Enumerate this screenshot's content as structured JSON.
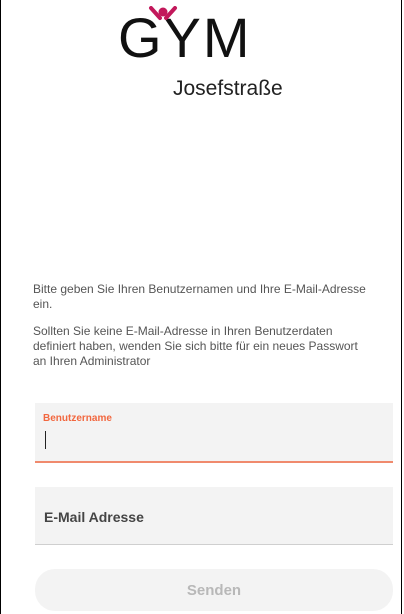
{
  "logo": {
    "title": "GYM",
    "subtitle": "Josefstraße",
    "mark_color": "#c2185b"
  },
  "instructions": {
    "line1": "Bitte geben Sie Ihren Benutzernamen und Ihre E-Mail-Adresse ein.",
    "line2": "Sollten Sie keine E-Mail-Adresse in Ihren Benutzerdaten definiert haben, wenden Sie sich bitte für ein neues Passwort an Ihren Administrator"
  },
  "form": {
    "username_label": "Benutzername",
    "username_value": "",
    "email_label": "E-Mail Adresse",
    "email_value": "",
    "submit_label": "Senden"
  },
  "colors": {
    "accent": "#f2673f",
    "field_bg": "#f3f3f3"
  }
}
